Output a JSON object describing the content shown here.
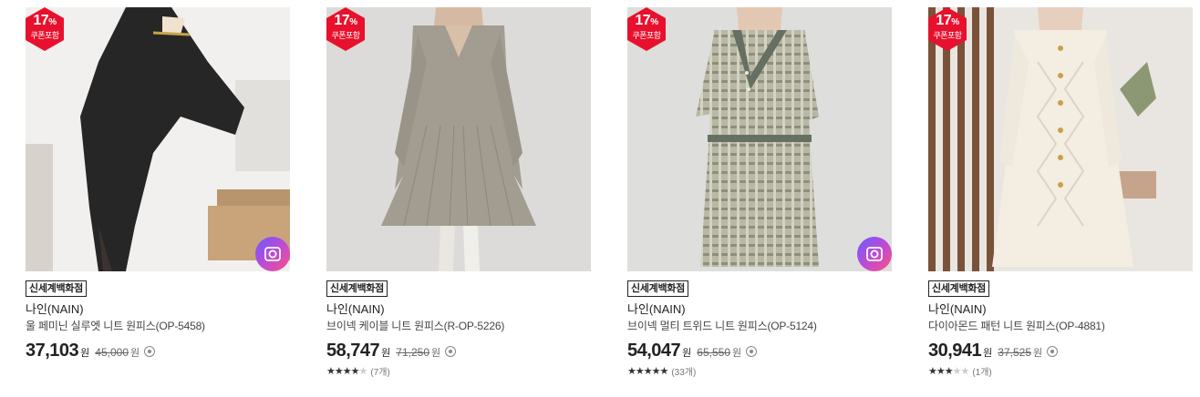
{
  "products": [
    {
      "badge_percent": "17",
      "badge_percent_sign": "%",
      "badge_label": "쿠폰포함",
      "has_camera_icon": true,
      "store": "신세계백화점",
      "brand": "나인(NAIN)",
      "name": "울 페미닌 실루엣 니트 원피스(OP-5458)",
      "price": "37,103",
      "price_unit": "원",
      "original_price": "45,000",
      "original_unit": "원",
      "stars": "",
      "stars_off": "",
      "review_count": ""
    },
    {
      "badge_percent": "17",
      "badge_percent_sign": "%",
      "badge_label": "쿠폰포함",
      "has_camera_icon": false,
      "store": "신세계백화점",
      "brand": "나인(NAIN)",
      "name": "브이넥 케이블 니트 원피스(R-OP-5226)",
      "price": "58,747",
      "price_unit": "원",
      "original_price": "71,250",
      "original_unit": "원",
      "stars": "★★★★",
      "stars_off": "★",
      "review_count": "(7개)"
    },
    {
      "badge_percent": "17",
      "badge_percent_sign": "%",
      "badge_label": "쿠폰포함",
      "has_camera_icon": true,
      "store": "신세계백화점",
      "brand": "나인(NAIN)",
      "name": "브이넥 멀티 트위드 니트 원피스(OP-5124)",
      "price": "54,047",
      "price_unit": "원",
      "original_price": "65,550",
      "original_unit": "원",
      "stars": "★★★★★",
      "stars_off": "",
      "review_count": "(33개)"
    },
    {
      "badge_percent": "17",
      "badge_percent_sign": "%",
      "badge_label": "쿠폰포함",
      "has_camera_icon": false,
      "store": "신세계백화점",
      "brand": "나인(NAIN)",
      "name": "다이아몬드 패턴 니트 원피스(OP-4881)",
      "price": "30,941",
      "price_unit": "원",
      "original_price": "37,525",
      "original_unit": "원",
      "stars": "★★★",
      "stars_off": "★★",
      "review_count": "(1개)"
    }
  ],
  "colors": {
    "badge_red": "#e8112d",
    "text_dark": "#222222",
    "star_on": "#333333",
    "star_off": "#cccccc"
  }
}
